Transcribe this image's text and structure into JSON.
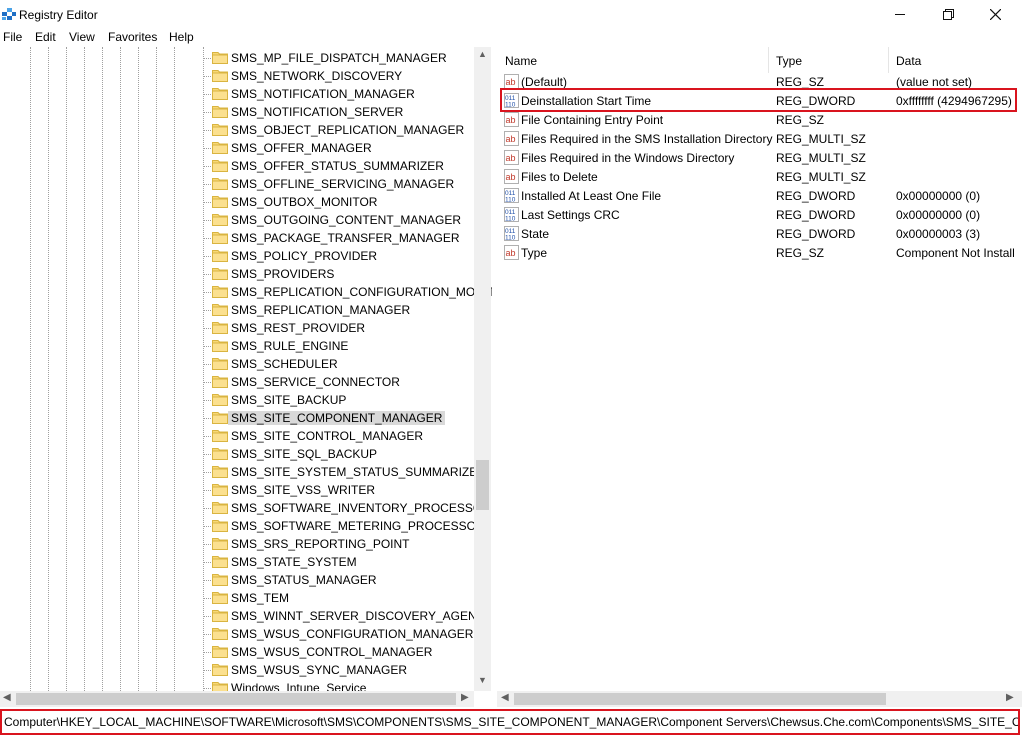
{
  "window": {
    "title": "Registry Editor",
    "icon": "registry-editor-icon",
    "controls": {
      "minimize": "minimize-icon",
      "maximize": "restore-icon",
      "close": "close-icon"
    }
  },
  "menu": [
    "File",
    "Edit",
    "View",
    "Favorites",
    "Help"
  ],
  "tree": {
    "selected": "SMS_SITE_COMPONENT_MANAGER",
    "items": [
      "SMS_MP_FILE_DISPATCH_MANAGER",
      "SMS_NETWORK_DISCOVERY",
      "SMS_NOTIFICATION_MANAGER",
      "SMS_NOTIFICATION_SERVER",
      "SMS_OBJECT_REPLICATION_MANAGER",
      "SMS_OFFER_MANAGER",
      "SMS_OFFER_STATUS_SUMMARIZER",
      "SMS_OFFLINE_SERVICING_MANAGER",
      "SMS_OUTBOX_MONITOR",
      "SMS_OUTGOING_CONTENT_MANAGER",
      "SMS_PACKAGE_TRANSFER_MANAGER",
      "SMS_POLICY_PROVIDER",
      "SMS_PROVIDERS",
      "SMS_REPLICATION_CONFIGURATION_MONITO",
      "SMS_REPLICATION_MANAGER",
      "SMS_REST_PROVIDER",
      "SMS_RULE_ENGINE",
      "SMS_SCHEDULER",
      "SMS_SERVICE_CONNECTOR",
      "SMS_SITE_BACKUP",
      "SMS_SITE_COMPONENT_MANAGER",
      "SMS_SITE_CONTROL_MANAGER",
      "SMS_SITE_SQL_BACKUP",
      "SMS_SITE_SYSTEM_STATUS_SUMMARIZER",
      "SMS_SITE_VSS_WRITER",
      "SMS_SOFTWARE_INVENTORY_PROCESSOR",
      "SMS_SOFTWARE_METERING_PROCESSOR",
      "SMS_SRS_REPORTING_POINT",
      "SMS_STATE_SYSTEM",
      "SMS_STATUS_MANAGER",
      "SMS_TEM",
      "SMS_WINNT_SERVER_DISCOVERY_AGENT",
      "SMS_WSUS_CONFIGURATION_MANAGER",
      "SMS_WSUS_CONTROL_MANAGER",
      "SMS_WSUS_SYNC_MANAGER",
      "Windows_Intune_Service"
    ]
  },
  "list": {
    "columns": [
      "Name",
      "Type",
      "Data"
    ],
    "rows": [
      {
        "name": "(Default)",
        "type": "REG_SZ",
        "data": "(value not set)",
        "icon": "string-value-icon"
      },
      {
        "name": "Deinstallation Start Time",
        "type": "REG_DWORD",
        "data": "0xffffffff (4294967295)",
        "icon": "binary-value-icon",
        "highlighted": true
      },
      {
        "name": "File Containing Entry Point",
        "type": "REG_SZ",
        "data": "",
        "icon": "string-value-icon"
      },
      {
        "name": "Files Required in the SMS Installation Directory",
        "type": "REG_MULTI_SZ",
        "data": "",
        "icon": "string-value-icon"
      },
      {
        "name": "Files Required in the Windows Directory",
        "type": "REG_MULTI_SZ",
        "data": "",
        "icon": "string-value-icon"
      },
      {
        "name": "Files to Delete",
        "type": "REG_MULTI_SZ",
        "data": "",
        "icon": "string-value-icon"
      },
      {
        "name": "Installed At Least One File",
        "type": "REG_DWORD",
        "data": "0x00000000 (0)",
        "icon": "binary-value-icon"
      },
      {
        "name": "Last Settings CRC",
        "type": "REG_DWORD",
        "data": "0x00000000 (0)",
        "icon": "binary-value-icon"
      },
      {
        "name": "State",
        "type": "REG_DWORD",
        "data": "0x00000003 (3)",
        "icon": "binary-value-icon"
      },
      {
        "name": "Type",
        "type": "REG_SZ",
        "data": "Component Not Install",
        "icon": "string-value-icon"
      }
    ]
  },
  "address": "Computer\\HKEY_LOCAL_MACHINE\\SOFTWARE\\Microsoft\\SMS\\COMPONENTS\\SMS_SITE_COMPONENT_MANAGER\\Component Servers\\Chewsus.Che.com\\Components\\SMS_SITE_COMPON",
  "colors": {
    "highlight_border": "#d9141e",
    "selection": "#d9d9d9",
    "folder": "#f8d775"
  }
}
